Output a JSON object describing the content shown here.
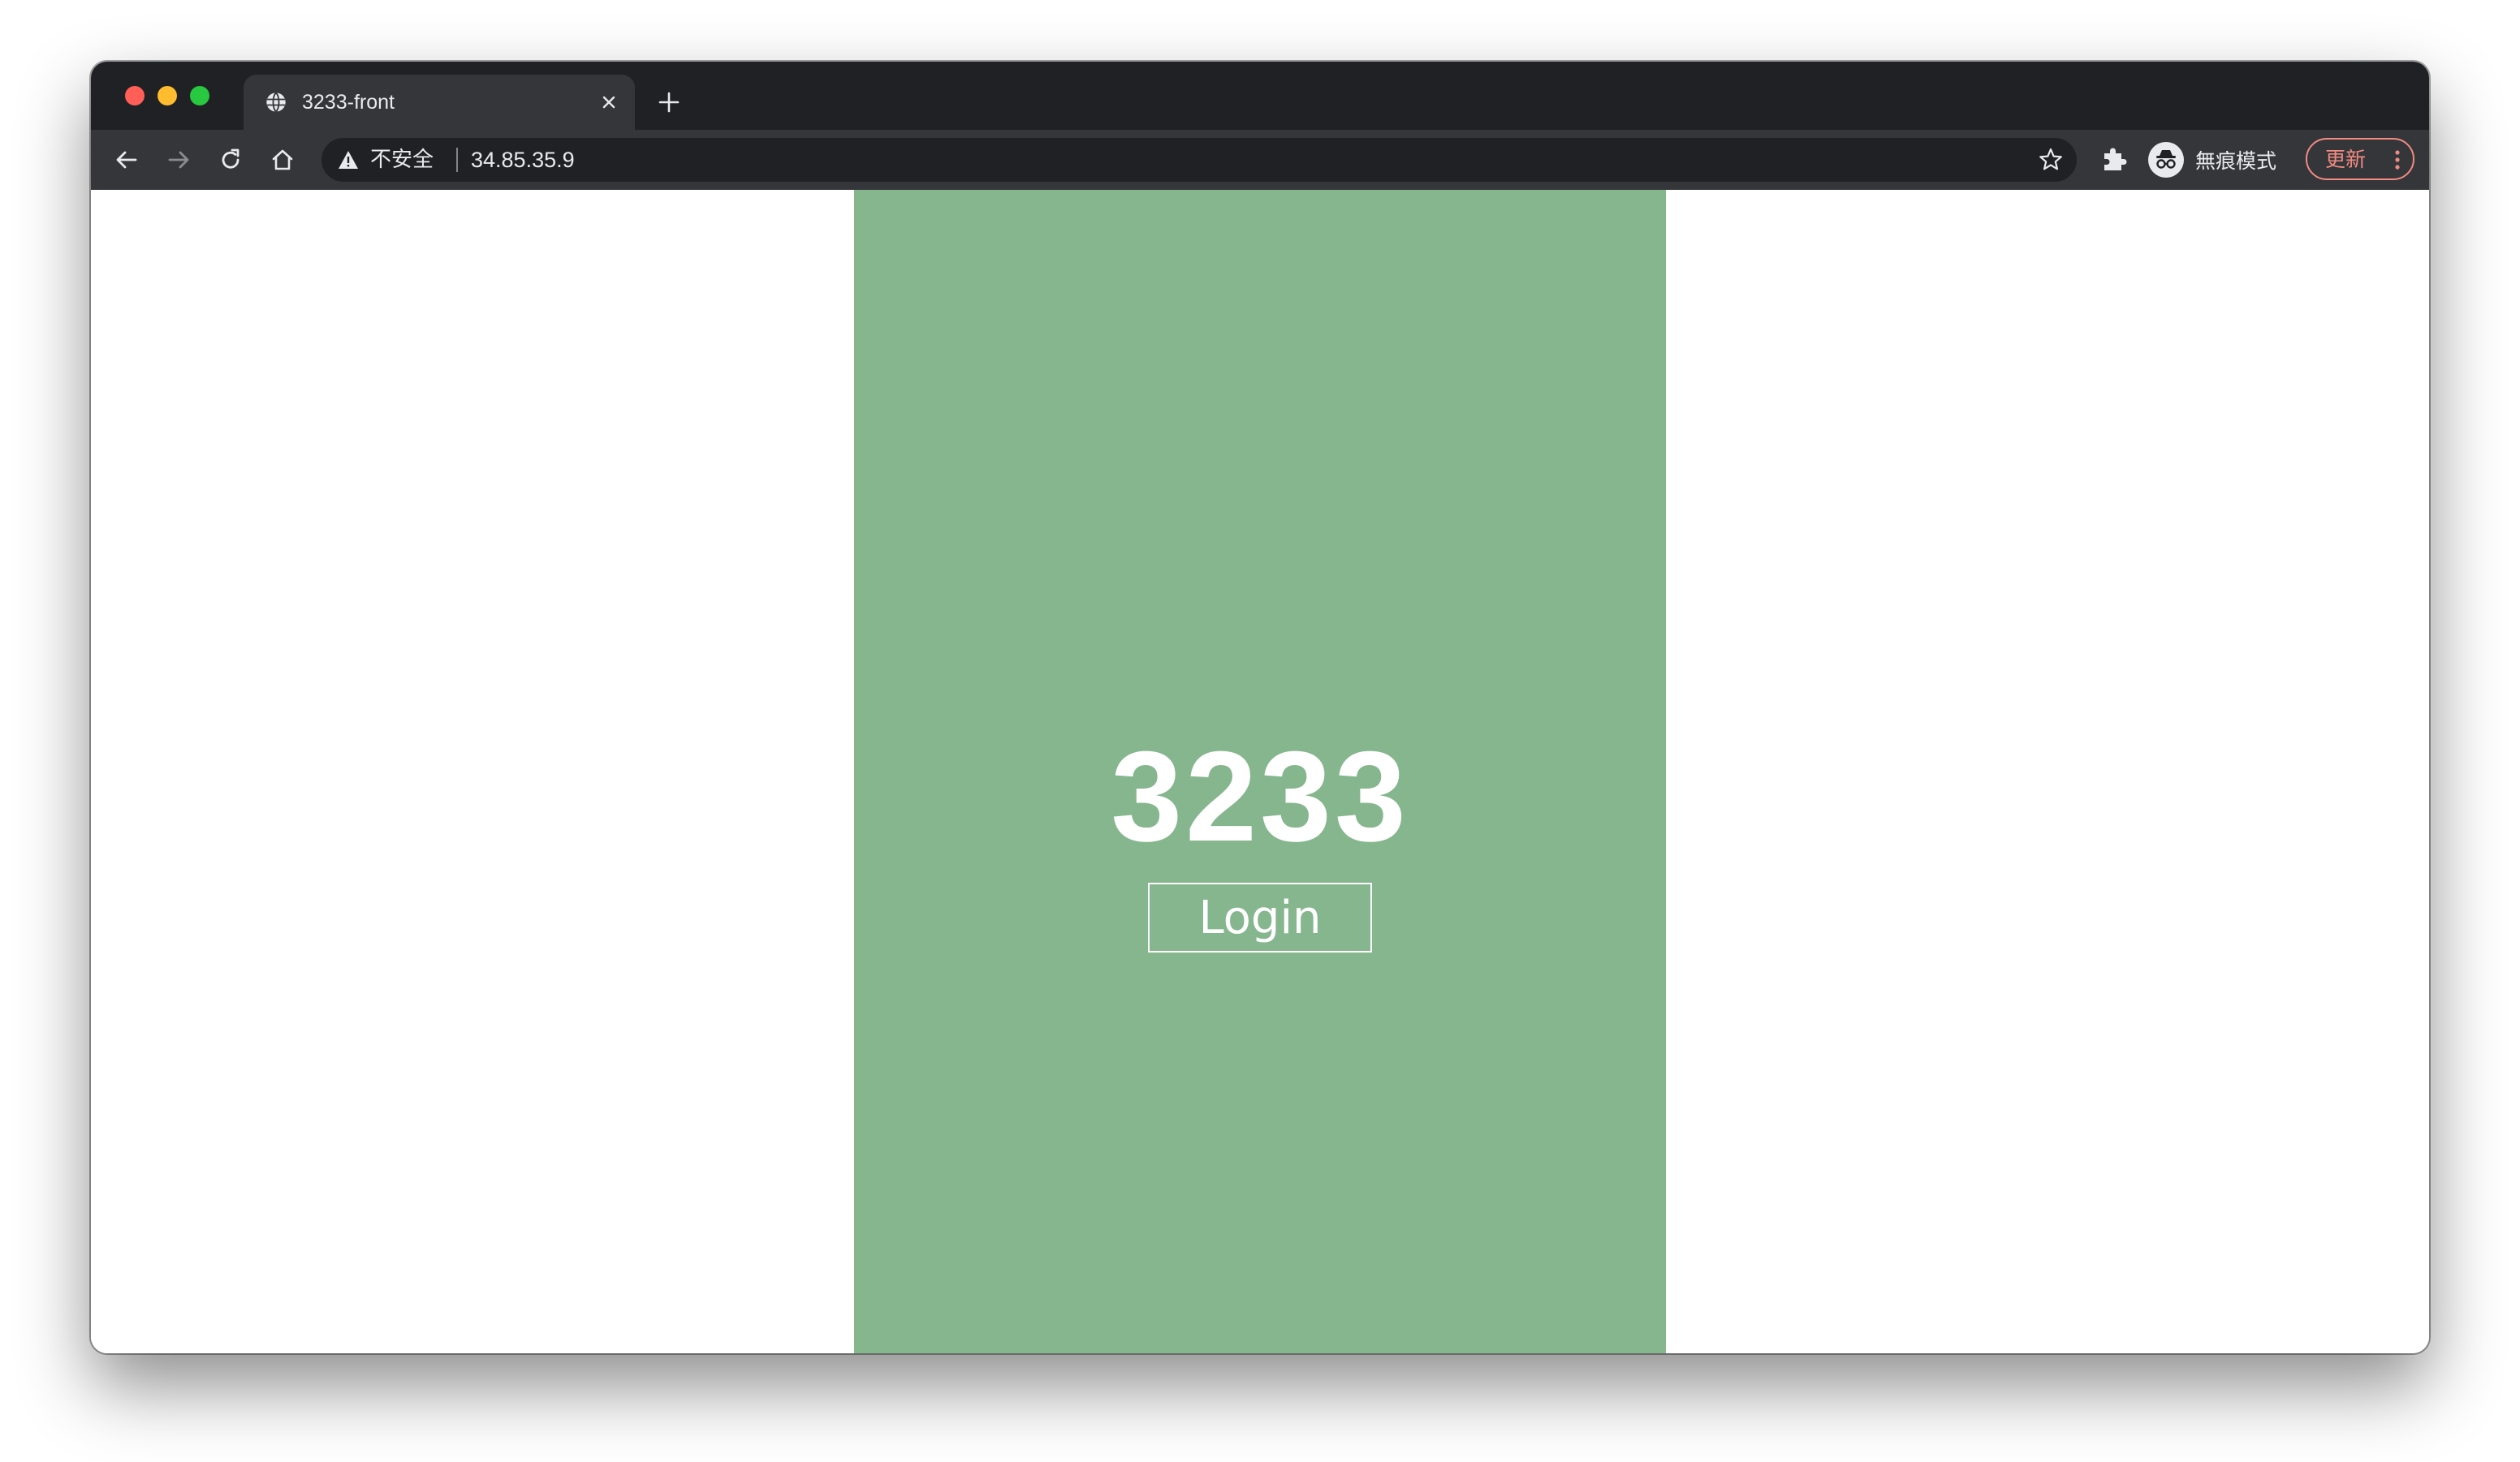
{
  "browser": {
    "tab": {
      "title": "3233-front",
      "favicon": "globe-icon",
      "close_icon": "close-icon"
    },
    "new_tab_icon": "plus-icon",
    "toolbar": {
      "back_icon": "arrow-left-icon",
      "forward_icon": "arrow-right-icon",
      "reload_icon": "reload-icon",
      "home_icon": "home-icon",
      "security_icon": "warning-icon",
      "security_label": "不安全",
      "url": "34.85.35.9",
      "bookmark_icon": "star-icon",
      "extensions_icon": "puzzle-icon",
      "incognito_icon": "incognito-icon",
      "incognito_label": "無痕模式",
      "update_label": "更新",
      "menu_icon": "kebab-menu-icon"
    },
    "colors": {
      "tabstrip": "#202124",
      "toolbar": "#35363a",
      "update_accent": "#f28b82"
    }
  },
  "page": {
    "brand": "3233",
    "login_label": "Login",
    "colors": {
      "panel": "#86b68e",
      "background": "#ffffff",
      "text": "#ffffff"
    }
  }
}
